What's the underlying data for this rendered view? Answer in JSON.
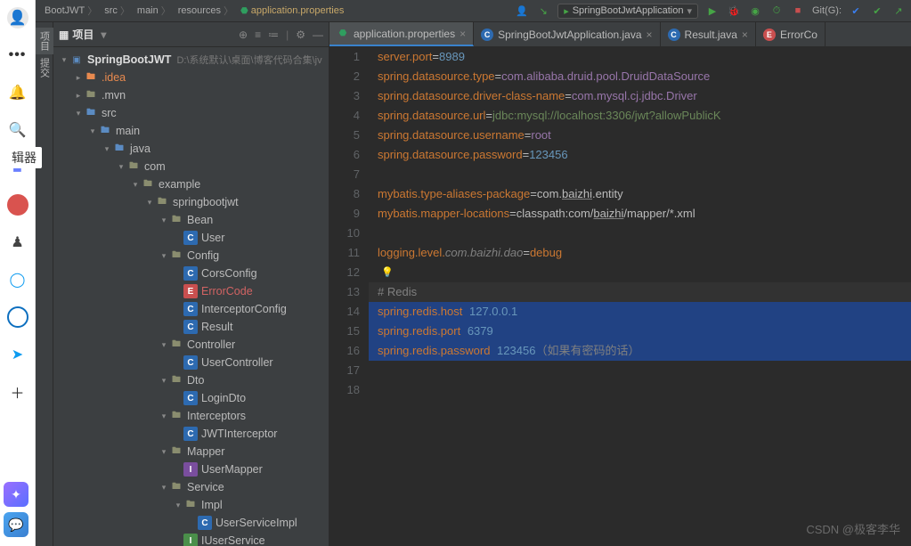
{
  "breadcrumbs": [
    "BootJWT",
    "src",
    "main",
    "resources",
    "application.properties"
  ],
  "runConfig": "SpringBootJwtApplication",
  "gitLabel": "Git(G):",
  "projectPanel": {
    "title": "项目",
    "root": "SpringBootJWT",
    "rootPath": "D:\\系统默认\\桌面\\博客代码合集\\jv"
  },
  "tree": [
    {
      "d": 0,
      "a": "d",
      "t": "root",
      "n": "SpringBootJWT"
    },
    {
      "d": 1,
      "a": "r",
      "t": "excl",
      "n": ".idea"
    },
    {
      "d": 1,
      "a": "r",
      "t": "fld",
      "n": ".mvn"
    },
    {
      "d": 1,
      "a": "d",
      "t": "fldb",
      "n": "src"
    },
    {
      "d": 2,
      "a": "d",
      "t": "fldb",
      "n": "main"
    },
    {
      "d": 3,
      "a": "d",
      "t": "fldb",
      "n": "java"
    },
    {
      "d": 4,
      "a": "d",
      "t": "fld",
      "n": "com"
    },
    {
      "d": 5,
      "a": "d",
      "t": "fld",
      "n": "example"
    },
    {
      "d": 6,
      "a": "d",
      "t": "fld",
      "n": "springbootjwt"
    },
    {
      "d": 7,
      "a": "d",
      "t": "fld",
      "n": "Bean"
    },
    {
      "d": 8,
      "a": "",
      "t": "C",
      "n": "User"
    },
    {
      "d": 7,
      "a": "d",
      "t": "fld",
      "n": "Config"
    },
    {
      "d": 8,
      "a": "",
      "t": "C",
      "n": "CorsConfig"
    },
    {
      "d": 8,
      "a": "",
      "t": "E",
      "n": "ErrorCode",
      "red": true
    },
    {
      "d": 8,
      "a": "",
      "t": "C",
      "n": "InterceptorConfig"
    },
    {
      "d": 8,
      "a": "",
      "t": "C",
      "n": "Result"
    },
    {
      "d": 7,
      "a": "d",
      "t": "fld",
      "n": "Controller"
    },
    {
      "d": 8,
      "a": "",
      "t": "C",
      "n": "UserController"
    },
    {
      "d": 7,
      "a": "d",
      "t": "fld",
      "n": "Dto"
    },
    {
      "d": 8,
      "a": "",
      "t": "C",
      "n": "LoginDto"
    },
    {
      "d": 7,
      "a": "d",
      "t": "fld",
      "n": "Interceptors"
    },
    {
      "d": 8,
      "a": "",
      "t": "C",
      "n": "JWTInterceptor"
    },
    {
      "d": 7,
      "a": "d",
      "t": "fld",
      "n": "Mapper"
    },
    {
      "d": 8,
      "a": "",
      "t": "A",
      "n": "UserMapper"
    },
    {
      "d": 7,
      "a": "d",
      "t": "fld",
      "n": "Service"
    },
    {
      "d": 8,
      "a": "d",
      "t": "fld",
      "n": "Impl"
    },
    {
      "d": 9,
      "a": "",
      "t": "C",
      "n": "UserServiceImpl"
    },
    {
      "d": 8,
      "a": "",
      "t": "I",
      "n": "IUserService"
    }
  ],
  "tabs": [
    {
      "icon": "prop",
      "label": "application.properties",
      "active": true,
      "close": true
    },
    {
      "icon": "C",
      "label": "SpringBootJwtApplication.java",
      "active": false,
      "close": true
    },
    {
      "icon": "C",
      "label": "Result.java",
      "active": false,
      "close": true
    },
    {
      "icon": "E",
      "label": "ErrorCo",
      "active": false,
      "close": false
    }
  ],
  "lines": [
    {
      "n": 1,
      "seg": [
        [
          "k",
          "server.port"
        ],
        [
          "",
          "="
        ],
        [
          "v",
          "8989"
        ]
      ]
    },
    {
      "n": 2,
      "seg": [
        [
          "k",
          "spring.datasource.type"
        ],
        [
          "",
          "="
        ],
        [
          "pkg",
          "com.alibaba.druid.pool.DruidDataSource"
        ]
      ]
    },
    {
      "n": 3,
      "seg": [
        [
          "k",
          "spring.datasource.driver-class-name"
        ],
        [
          "",
          "="
        ],
        [
          "pkg",
          "com.mysql.cj.jdbc.Driver"
        ]
      ]
    },
    {
      "n": 4,
      "seg": [
        [
          "k",
          "spring.datasource.url"
        ],
        [
          "",
          "="
        ],
        [
          "s",
          "jdbc:mysql://localhost:3306/jwt?allowPublicK"
        ]
      ]
    },
    {
      "n": 5,
      "seg": [
        [
          "k",
          "spring.datasource.username"
        ],
        [
          "",
          "="
        ],
        [
          "pkg",
          "root"
        ]
      ]
    },
    {
      "n": 6,
      "seg": [
        [
          "k",
          "spring.datasource.password"
        ],
        [
          "",
          "="
        ],
        [
          "v",
          "123456"
        ]
      ]
    },
    {
      "n": 7,
      "seg": [
        [
          "",
          ""
        ]
      ]
    },
    {
      "n": 8,
      "seg": [
        [
          "k",
          "mybatis.type-aliases-package"
        ],
        [
          "",
          "=com."
        ],
        [
          "u",
          "baizhi"
        ],
        [
          "",
          ".entity"
        ]
      ]
    },
    {
      "n": 9,
      "seg": [
        [
          "k",
          "mybatis.mapper-locations"
        ],
        [
          "",
          "=classpath:com/"
        ],
        [
          "u",
          "baizhi"
        ],
        [
          "",
          "/mapper/*.xml"
        ]
      ]
    },
    {
      "n": 10,
      "seg": [
        [
          "",
          ""
        ]
      ]
    },
    {
      "n": 11,
      "seg": [
        [
          "k",
          "logging.level."
        ],
        [
          "i",
          "com.baizhi.dao"
        ],
        [
          "",
          "="
        ],
        [
          "k",
          "debug"
        ]
      ]
    },
    {
      "n": 12,
      "seg": [
        [
          "",
          ""
        ]
      ],
      "bulb": true
    },
    {
      "n": 13,
      "sel": true,
      "cur": true,
      "seg": [
        [
          "c",
          "# Redis"
        ]
      ]
    },
    {
      "n": 14,
      "sel": true,
      "seg": [
        [
          "k",
          "spring.redis.host"
        ],
        [
          "",
          "="
        ],
        [
          "v",
          "127.0.0.1"
        ]
      ]
    },
    {
      "n": 15,
      "sel": true,
      "seg": [
        [
          "k",
          "spring.redis.port"
        ],
        [
          "",
          "="
        ],
        [
          "v",
          "6379"
        ]
      ]
    },
    {
      "n": 16,
      "sel": true,
      "seg": [
        [
          "k",
          "spring.redis.password"
        ],
        [
          "",
          "="
        ],
        [
          "v",
          "123456"
        ],
        [
          "c",
          "（如果有密码的话）"
        ]
      ]
    },
    {
      "n": 17,
      "seg": [
        [
          "",
          ""
        ]
      ]
    },
    {
      "n": 18,
      "seg": [
        [
          "",
          ""
        ]
      ]
    }
  ],
  "watermark": "CSDN @极客李华",
  "sideLabels": {
    "project": "项目",
    "commit": "提交"
  },
  "brokenLabel": "辑器"
}
